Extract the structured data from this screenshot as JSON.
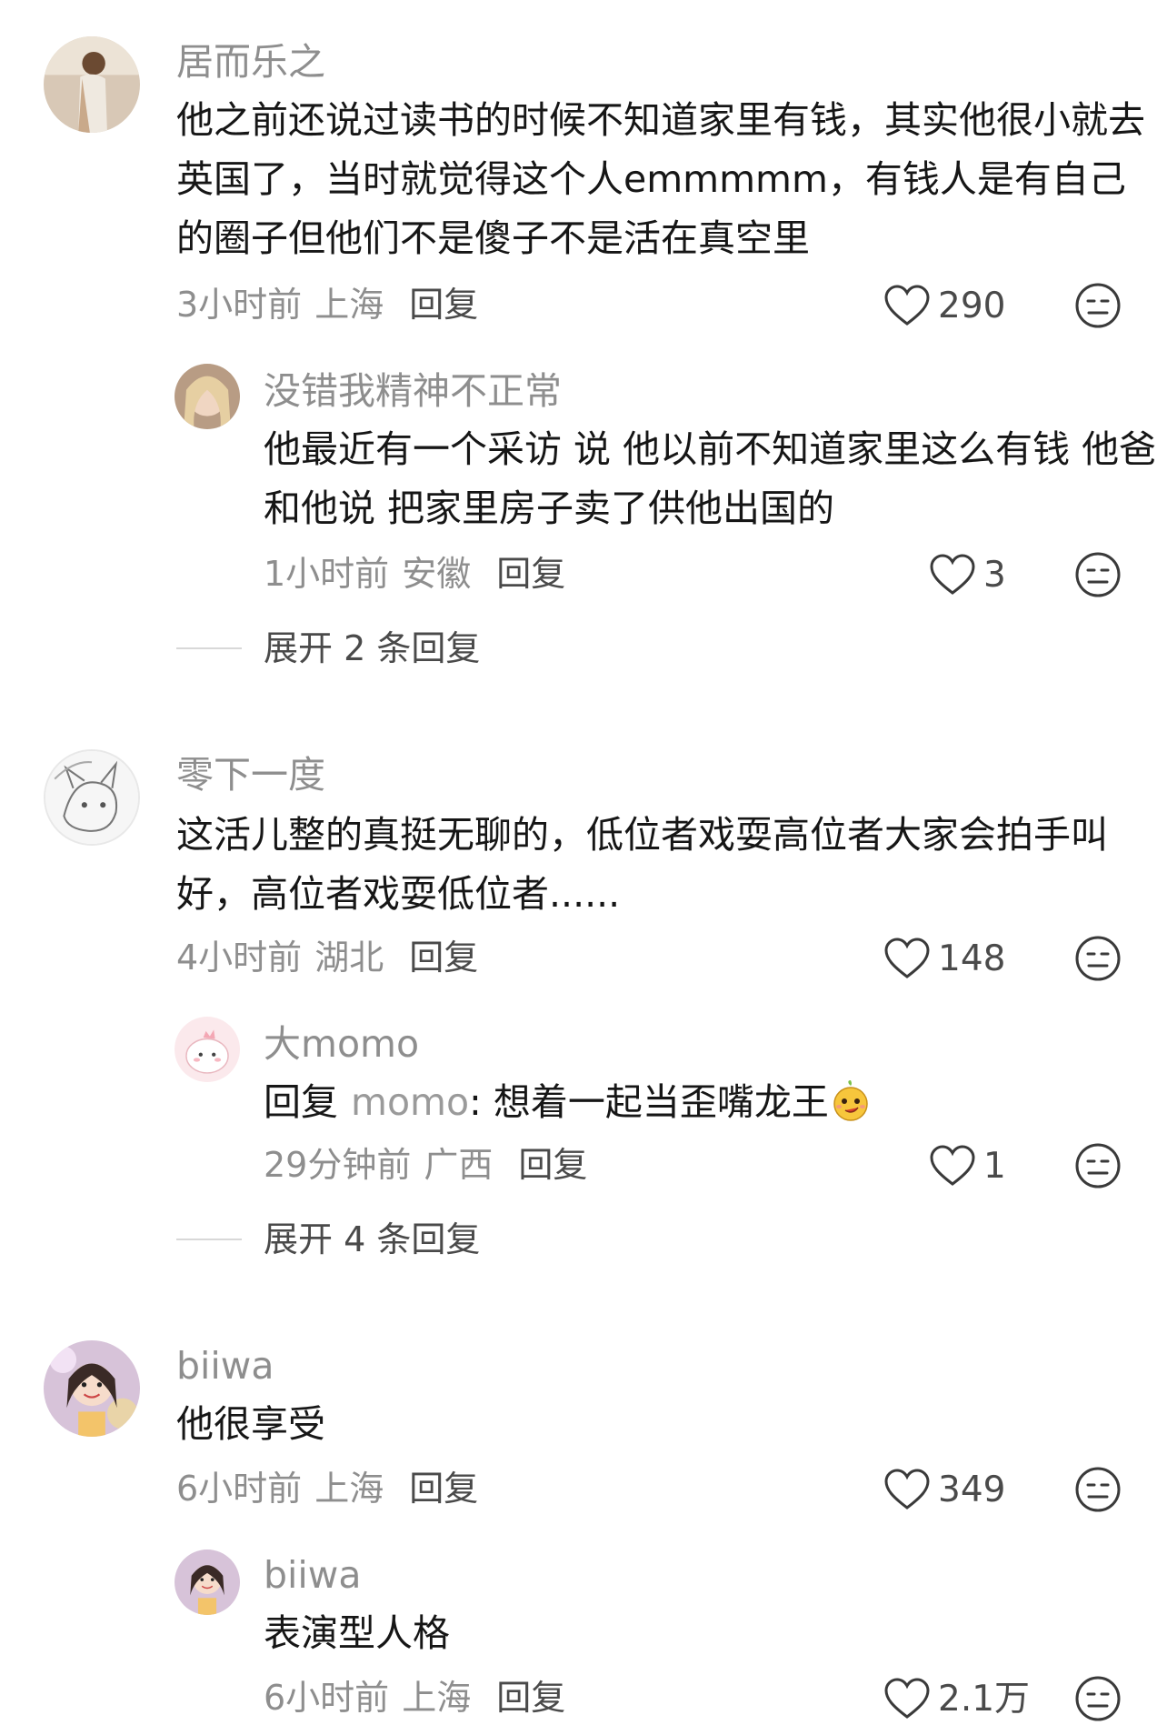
{
  "threads": [
    {
      "comment": {
        "username": "居而乐之",
        "text": "他之前还说过读书的时候不知道家里有钱，其实他很小就去英国了，当时就觉得这个人emmmmm，有钱人是有自己的圈子但他们不是傻子不是活在真空里",
        "time": "3小时前",
        "location": "上海",
        "reply_label": "回复",
        "likes": "290"
      },
      "reply": {
        "username": "没错我精神不正常",
        "text": "他最近有一个采访 说 他以前不知道家里这么有钱 他爸和他说 把家里房子卖了供他出国的",
        "time": "1小时前",
        "location": "安徽",
        "reply_label": "回复",
        "likes": "3"
      },
      "expand_label": "展开 2 条回复"
    },
    {
      "comment": {
        "username": "零下一度",
        "text": "这活儿整的真挺无聊的，低位者戏耍高位者大家会拍手叫好，高位者戏耍低位者......",
        "time": "4小时前",
        "location": "湖北",
        "reply_label": "回复",
        "likes": "148"
      },
      "reply": {
        "username": "大momo",
        "reply_prefix": "回复",
        "reply_target": "momo",
        "text": ": 想着一起当歪嘴龙王",
        "emoji": "smirk-emoji",
        "time": "29分钟前",
        "location": "广西",
        "reply_label": "回复",
        "likes": "1"
      },
      "expand_label": "展开 4 条回复"
    },
    {
      "comment": {
        "username": "biiwa",
        "text": "他很享受",
        "time": "6小时前",
        "location": "上海",
        "reply_label": "回复",
        "likes": "349"
      },
      "reply": {
        "username": "biiwa",
        "text": "表演型人格",
        "time": "6小时前",
        "location": "上海",
        "reply_label": "回复",
        "likes": "2.1万"
      }
    }
  ],
  "icons": {
    "like": "heart-outline-icon",
    "dislike": "meh-face-icon"
  },
  "colors": {
    "text": "#161616",
    "muted": "#8e8e8e",
    "action": "#4a4a4a"
  }
}
